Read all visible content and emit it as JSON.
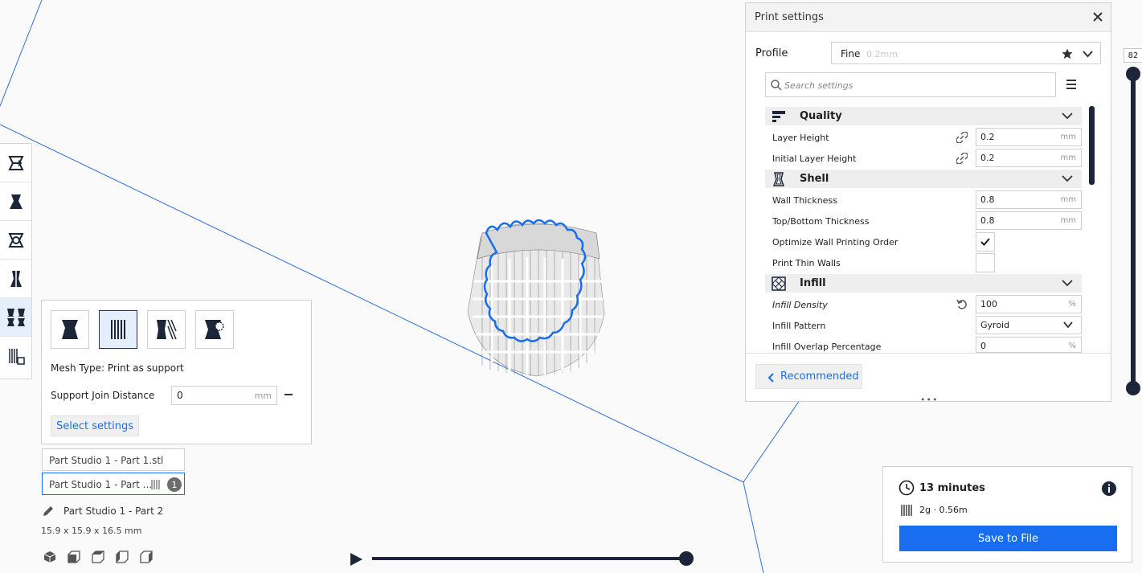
{
  "left_toolbar": {
    "tools": [
      "move-tool",
      "scale-tool",
      "rotate-tool",
      "mirror-tool",
      "per-model-settings-tool",
      "support-blocker-tool"
    ],
    "active_tool": "per-model-settings-tool"
  },
  "mesh_panel": {
    "mesh_types": [
      "normal-model",
      "print-as-support",
      "dont-support-overlaps",
      "modify-settings-for-overlaps"
    ],
    "selected_mesh_type": "print-as-support",
    "mesh_type_text": "Mesh Type: Print as support",
    "support_join_label": "Support Join Distance",
    "support_join_value": "0",
    "support_join_unit": "mm",
    "select_settings_label": "Select settings"
  },
  "object_list": {
    "items": [
      {
        "name": "Part Studio 1 - Part 1.stl"
      },
      {
        "name": "Part Studio 1 - Part ...",
        "badge": "1"
      }
    ],
    "current_object": "Part Studio 1 - Part 2",
    "dimensions": "15.9 x 15.9 x 16.5 mm"
  },
  "print_settings": {
    "title": "Print settings",
    "profile_label": "Profile",
    "profile_name": "Fine",
    "profile_sub": "0.2mm",
    "search_placeholder": "Search settings",
    "categories": {
      "quality": {
        "label": "Quality",
        "settings": [
          {
            "label": "Layer Height",
            "value": "0.2",
            "unit": "mm"
          },
          {
            "label": "Initial Layer Height",
            "value": "0.2",
            "unit": "mm"
          }
        ]
      },
      "shell": {
        "label": "Shell",
        "settings": [
          {
            "label": "Wall Thickness",
            "value": "0.8",
            "unit": "mm"
          },
          {
            "label": "Top/Bottom Thickness",
            "value": "0.8",
            "unit": "mm"
          },
          {
            "label": "Optimize Wall Printing Order",
            "checked": true
          },
          {
            "label": "Print Thin Walls",
            "checked": false
          }
        ]
      },
      "infill": {
        "label": "Infill",
        "settings": [
          {
            "label": "Infill Density",
            "value": "100",
            "unit": "%"
          },
          {
            "label": "Infill Pattern",
            "value": "Gyroid"
          },
          {
            "label": "Infill Overlap Percentage",
            "value": "0",
            "unit": "%"
          }
        ]
      }
    },
    "recommended_label": "Recommended"
  },
  "layer_view": {
    "current_layer": "82"
  },
  "estimate": {
    "time": "13 minutes",
    "material": "2g · 0.56m",
    "save_label": "Save to File"
  },
  "colors": {
    "accent": "#196ef0",
    "dark": "#1d2538",
    "model_outline": "#196ef0"
  }
}
